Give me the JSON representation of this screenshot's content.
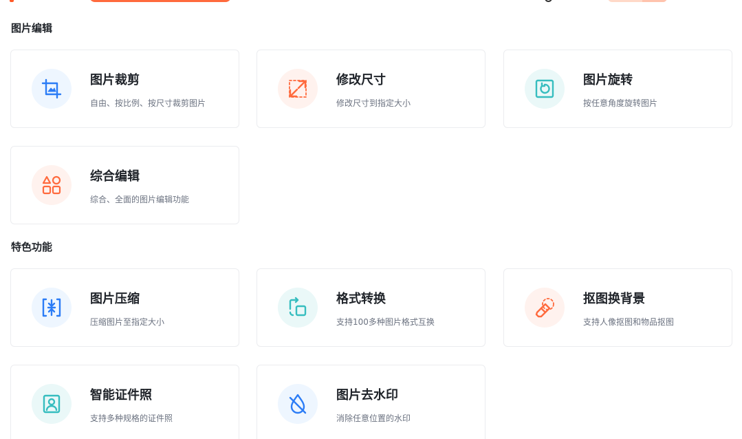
{
  "sections": [
    {
      "title": "图片编辑",
      "cards": [
        {
          "title": "图片裁剪",
          "desc": "自由、按比例、按尺寸裁剪图片",
          "icon": "crop-icon"
        },
        {
          "title": "修改尺寸",
          "desc": "修改尺寸到指定大小",
          "icon": "resize-icon"
        },
        {
          "title": "图片旋转",
          "desc": "按任意角度旋转图片",
          "icon": "rotate-icon"
        },
        {
          "title": "综合编辑",
          "desc": "综合、全面的图片编辑功能",
          "icon": "shapes-icon"
        }
      ]
    },
    {
      "title": "特色功能",
      "cards": [
        {
          "title": "图片压缩",
          "desc": "压缩图片至指定大小",
          "icon": "compress-icon"
        },
        {
          "title": "格式转换",
          "desc": "支持100多种图片格式互换",
          "icon": "convert-icon"
        },
        {
          "title": "抠图换背景",
          "desc": "支持人像抠图和物品抠图",
          "icon": "eraser-icon"
        },
        {
          "title": "智能证件照",
          "desc": "支持多种规格的证件照",
          "icon": "id-photo-icon"
        },
        {
          "title": "图片去水印",
          "desc": "消除任意位置的水印",
          "icon": "watermark-remove-icon"
        }
      ]
    }
  ],
  "colors": {
    "blue": "#2b7cf6",
    "orange": "#ff6a3d",
    "teal": "#36bdbf",
    "card_border": "#ebecef"
  }
}
